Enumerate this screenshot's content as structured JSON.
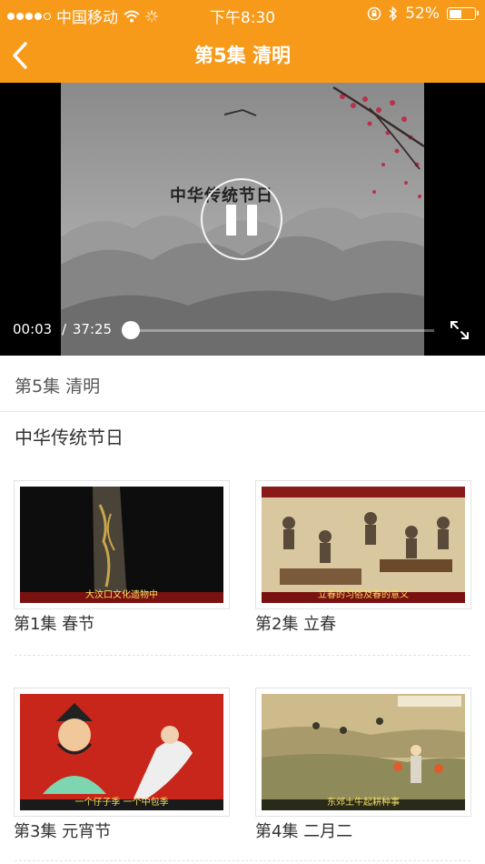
{
  "status_bar": {
    "carrier": "中国移动",
    "time": "下午8:30",
    "battery_pct": "52%",
    "battery_level": 0.52
  },
  "nav": {
    "back_icon": "chevron-left-icon",
    "title": "第5集 清明"
  },
  "player": {
    "overlay_title": "中华传统节日",
    "current_time": "00:03",
    "separator": "/",
    "duration": "37:25",
    "progress": 0.0013
  },
  "episode": {
    "title": "第5集 清明"
  },
  "series": {
    "title": "中华传统节日"
  },
  "episodes": [
    {
      "label": "第1集 春节",
      "caption": "大汶口文化遗物中"
    },
    {
      "label": "第2集 立春",
      "caption": "立春的习俗及春的意义"
    },
    {
      "label": "第3集 元宵节",
      "caption": "一个仔子季 一个中包季"
    },
    {
      "label": "第4集 二月二",
      "caption": "东郊土牛起耕种事"
    }
  ],
  "colors": {
    "accent": "#f79a1a"
  }
}
